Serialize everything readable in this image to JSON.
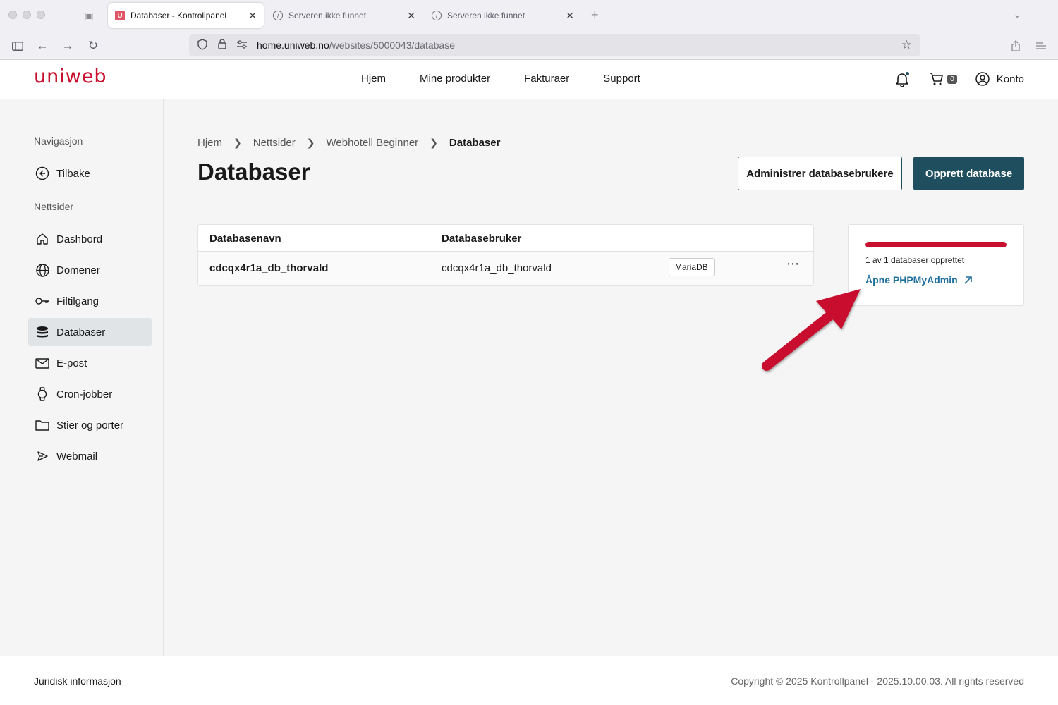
{
  "browser": {
    "tabs": [
      {
        "title": "Databaser - Kontrollpanel",
        "active": true
      },
      {
        "title": "Serveren ikke funnet",
        "active": false
      },
      {
        "title": "Serveren ikke funnet",
        "active": false
      }
    ],
    "url_host": "home.uniweb.no",
    "url_path": "/websites/5000043/database"
  },
  "header": {
    "logo": "uniweb",
    "nav": [
      "Hjem",
      "Mine produkter",
      "Fakturaer",
      "Support"
    ],
    "cart_count": "0",
    "account_label": "Konto"
  },
  "sidebar": {
    "nav_heading": "Navigasjon",
    "back_label": "Tilbake",
    "section_heading": "Nettsider",
    "items": [
      {
        "label": "Dashbord",
        "icon": "home-icon"
      },
      {
        "label": "Domener",
        "icon": "globe-icon"
      },
      {
        "label": "Filtilgang",
        "icon": "key-icon"
      },
      {
        "label": "Databaser",
        "icon": "database-icon",
        "active": true
      },
      {
        "label": "E-post",
        "icon": "mail-icon"
      },
      {
        "label": "Cron-jobber",
        "icon": "watch-icon"
      },
      {
        "label": "Stier og porter",
        "icon": "folder-icon"
      },
      {
        "label": "Webmail",
        "icon": "send-icon"
      }
    ]
  },
  "main": {
    "breadcrumb": [
      "Hjem",
      "Nettsider",
      "Webhotell Beginner",
      "Databaser"
    ],
    "title": "Databaser",
    "btn_manage_users": "Administrer databasebrukere",
    "btn_create": "Opprett database",
    "table": {
      "headers": [
        "Databasenavn",
        "Databasebruker"
      ],
      "rows": [
        {
          "name": "cdcqx4r1a_db_thorvald",
          "user": "cdcqx4r1a_db_thorvald",
          "engine": "MariaDB"
        }
      ]
    },
    "usage": {
      "text": "1 av 1 databaser opprettet",
      "used": 1,
      "total": 1,
      "link": "Åpne PHPMyAdmin"
    }
  },
  "footer": {
    "legal": "Juridisk informasjon",
    "copyright": "Copyright © 2025 Kontrollpanel - 2025.10.00.03. All rights reserved"
  },
  "colors": {
    "brand_red": "#c8102e",
    "primary": "#1f4e5f",
    "link": "#1f6f9f"
  }
}
